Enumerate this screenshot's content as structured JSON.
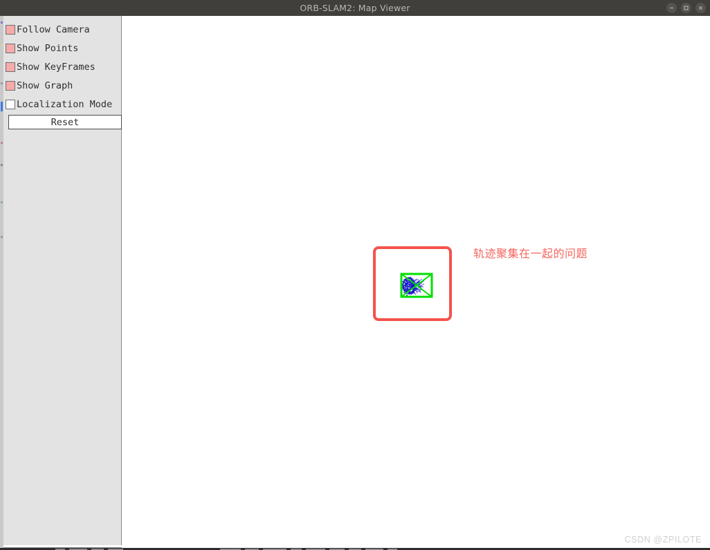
{
  "window": {
    "title": "ORB-SLAM2: Map Viewer",
    "controls": [
      {
        "name": "minimize",
        "glyph": "minimize-icon"
      },
      {
        "name": "maximize",
        "glyph": "maximize-icon"
      },
      {
        "name": "close",
        "glyph": "close-icon"
      }
    ]
  },
  "sidebar": {
    "checkboxes": [
      {
        "label": "Follow Camera",
        "checked": true
      },
      {
        "label": "Show Points",
        "checked": true
      },
      {
        "label": "Show KeyFrames",
        "checked": true
      },
      {
        "label": "Show Graph",
        "checked": true
      },
      {
        "label": "Localization Mode",
        "checked": false
      }
    ],
    "reset_label": "Reset"
  },
  "annotation": {
    "text": "轨迹聚集在一起的问题",
    "box_color": "#f4524c",
    "text_color": "#f4655e"
  },
  "viewport": {
    "keyframe_color": "#00e000",
    "graph_color": "#1414c8",
    "point_color": "#1414c8",
    "background": "#ffffff"
  },
  "watermark": {
    "text": "CSDN @ZPILOTE"
  },
  "colors": {
    "titlebar": "#403f3b",
    "titlebar_text": "#b9b7b2",
    "panel": "#e3e3e3",
    "checkbox_on": "#f7aaaa",
    "checkbox_off": "#ffffff",
    "label_text": "#2f2f2f"
  }
}
